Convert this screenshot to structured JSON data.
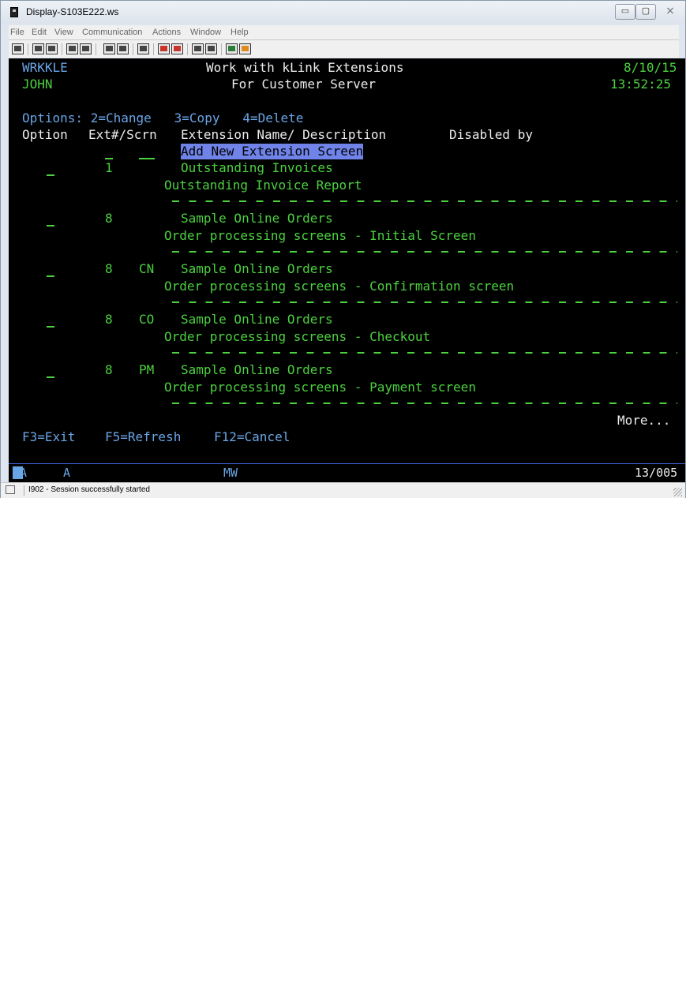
{
  "window": {
    "title": "Display-S103E222.ws",
    "controls": {
      "minimize": "▭",
      "maximize": "▢",
      "close": "⨯"
    }
  },
  "menu": [
    {
      "label": "File"
    },
    {
      "label": "Edit"
    },
    {
      "label": "View"
    },
    {
      "label": "Communication"
    },
    {
      "label": "Actions"
    },
    {
      "label": "Window"
    },
    {
      "label": "Help"
    }
  ],
  "toolbar": {
    "icons": [
      "print-screen-icon",
      "copy-icon",
      "paste-icon",
      "send-icon",
      "receive-icon",
      "display-icon",
      "display2-icon",
      "macro-icon",
      "record-icon",
      "stop-icon",
      "play-icon",
      "color-icon",
      "keyboard-icon"
    ]
  },
  "screen": {
    "program": "WRKKLE",
    "title": "Work with kLink Extensions",
    "date": "8/10/15",
    "user": "JOHN",
    "subtitle": "For Customer Server",
    "time": "13:52:25",
    "options_line": "Options: 2=Change   3=Copy   4=Delete",
    "headers": {
      "option": "Option",
      "ext": "Ext#/Scrn",
      "name": "Extension Name/ Description",
      "disabled": "Disabled by"
    },
    "add_new": "Add New Extension Screen",
    "rows": [
      {
        "ext": "1",
        "scrn": "",
        "name": "Outstanding Invoices",
        "description": "Outstanding Invoice Report"
      },
      {
        "ext": "8",
        "scrn": "",
        "name": "Sample Online Orders",
        "description": "Order processing screens - Initial Screen"
      },
      {
        "ext": "8",
        "scrn": "CN",
        "name": "Sample Online Orders",
        "description": "Order processing screens - Confirmation screen"
      },
      {
        "ext": "8",
        "scrn": "CO",
        "name": "Sample Online Orders",
        "description": "Order processing screens - Checkout"
      },
      {
        "ext": "8",
        "scrn": "PM",
        "name": "Sample Online Orders",
        "description": "Order processing screens - Payment screen"
      }
    ],
    "more": "More...",
    "fkeys": {
      "f3": "F3=Exit",
      "f5": "F5=Refresh",
      "f12": "F12=Cancel"
    }
  },
  "oia": {
    "ma": "MA",
    "a": "A",
    "mw": "MW",
    "cursor": "13/005"
  },
  "status": {
    "message": "I902 - Session successfully started"
  },
  "colors": {
    "green": "#4cd13f",
    "blue": "#6aa5e6",
    "white": "#ececec",
    "highlight": "#6f83e8"
  }
}
